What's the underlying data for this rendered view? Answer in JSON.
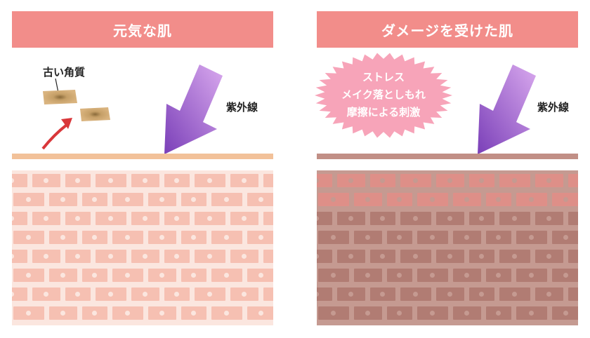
{
  "left_panel": {
    "title": "元気な肌",
    "uv_label": "紫外線",
    "old_keratin_label": "古い角質"
  },
  "right_panel": {
    "title": "ダメージを受けた肌",
    "uv_label": "紫外線",
    "stress_lines": [
      "ストレス",
      "メイク落としもれ",
      "摩擦による刺激"
    ]
  },
  "colors": {
    "header_bg": "#f28d8a",
    "healthy_line": "#f2c199",
    "healthy_tissue_bg": "#fbe6df",
    "healthy_cell": "#f6c0b2",
    "healthy_nucleus": "#fbe6df",
    "damaged_line": "#c18f86",
    "damaged_tissue_bg": "#c59a91",
    "damaged_cell": "#b17c73",
    "damaged_top_cell": "#de8f88",
    "damaged_nucleus": "#c59a91",
    "uv_arrow_dark": "#7a3fb8",
    "uv_arrow_light": "#d9a9ee",
    "stress_burst": "#f7a4b9",
    "flake": "#d4ae78",
    "red_arrow": "#d9373a"
  }
}
